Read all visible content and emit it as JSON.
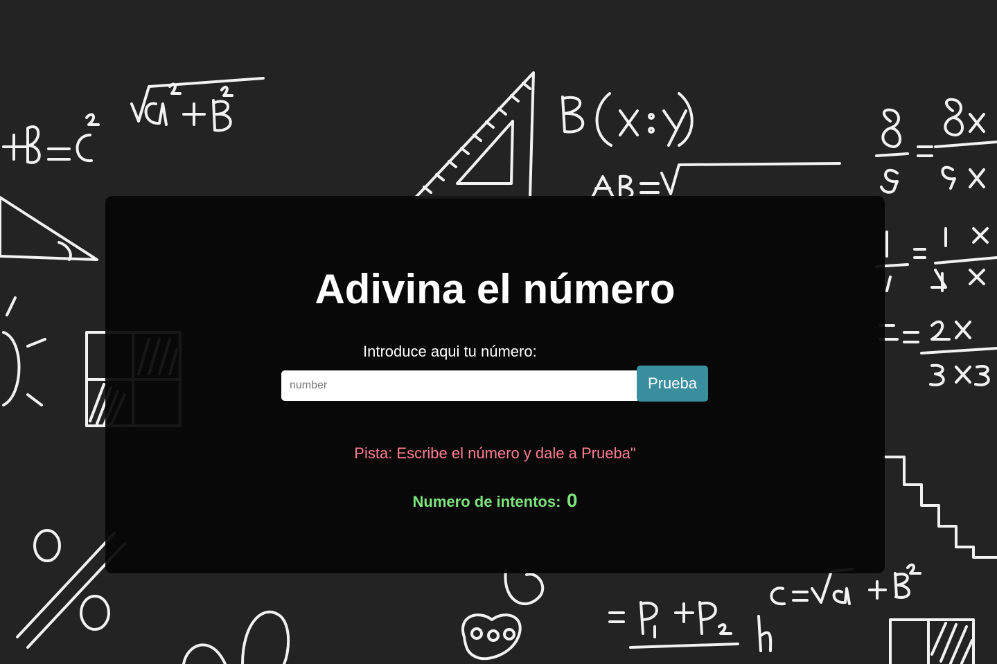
{
  "colors": {
    "background": "#232323",
    "panel": "#060606",
    "button": "#3a8f9f",
    "hint": "#ff7f93",
    "attempts": "#7ee57e"
  },
  "game": {
    "title": "Adivina el número",
    "input_label": "Introduce aqui tu número:",
    "input_placeholder": "number",
    "input_value": "",
    "submit_label": "Prueba",
    "hint_text": "Pista: Escribe el número y dale a Prueba\"",
    "attempts_label": "Numero de intentos:",
    "attempts_count": "0"
  }
}
